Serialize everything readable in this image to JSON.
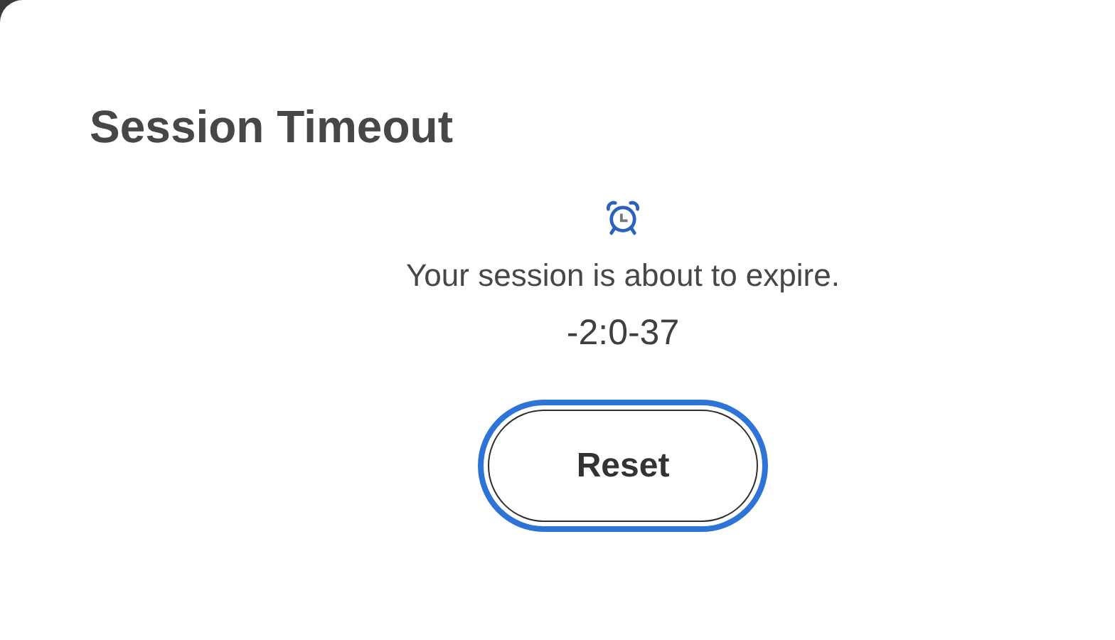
{
  "dialog": {
    "title": "Session Timeout",
    "message": "Your session is about to expire.",
    "countdown": "-2:0-37",
    "button": {
      "label": "Reset",
      "focused": true
    }
  }
}
